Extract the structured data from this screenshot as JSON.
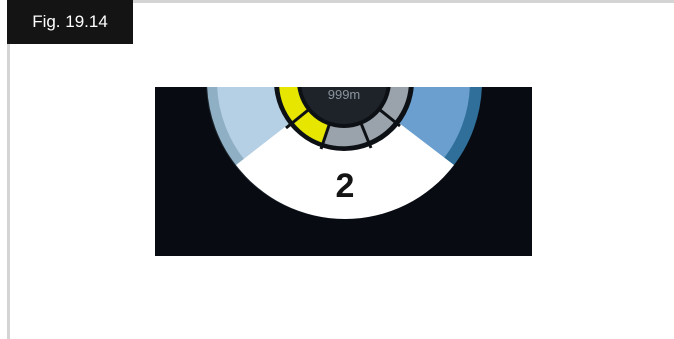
{
  "figure": {
    "label": "Fig. 19.14"
  },
  "gauge": {
    "distance_readout": "999m",
    "selected_number": "2",
    "colors": {
      "background": "#080b12",
      "bezel_dark": "#1c242c",
      "left_band_outer": "#8fafc4",
      "left_band_inner": "#b5cfe4",
      "right_band_outer": "#2f6f99",
      "right_band_inner": "#6a9fd0",
      "segment_yellow": "#e6e600",
      "segment_grey": "#9aa3ab",
      "center_disc": "#1e2329",
      "white_panel": "#ffffff",
      "number_color": "#141414"
    }
  }
}
